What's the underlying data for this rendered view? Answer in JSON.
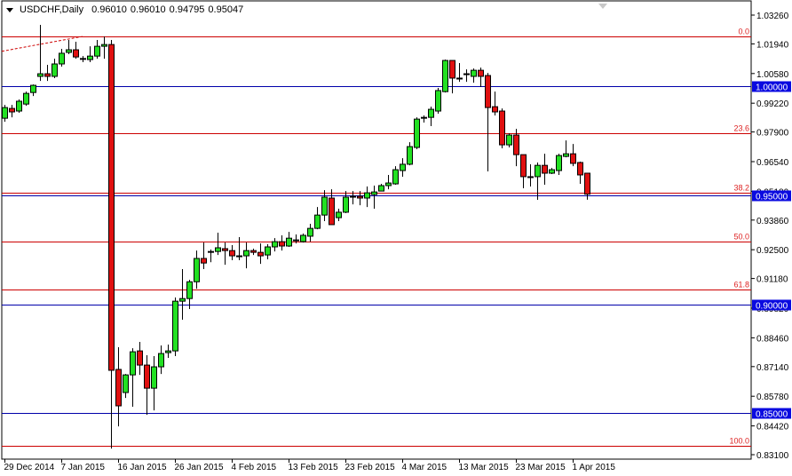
{
  "header": {
    "symbol_timeframe": "USDCHF,Daily",
    "ohlc_readout": [
      "0.96010",
      "0.96010",
      "0.94795",
      "0.95047"
    ]
  },
  "colors": {
    "bull": "#22e022",
    "bear": "#e01010",
    "outline": "#000000",
    "fib_line": "#cc0000",
    "fib_text": "#dd2222",
    "level_line": "#0000aa",
    "level_label_bg": "#0a0ae0",
    "level_label_text": "#ffffff"
  },
  "chart_data": {
    "type": "candlestick",
    "symbol": "USDCHF",
    "timeframe": "Daily",
    "ylim": [
      0.831,
      1.0326
    ],
    "y_ticks": [
      "1.03260",
      "1.01940",
      "1.00580",
      "0.99220",
      "0.97900",
      "0.96540",
      "0.95180",
      "0.93860",
      "0.92500",
      "0.91180",
      "0.89820",
      "0.88460",
      "0.87140",
      "0.85780",
      "0.84420",
      "0.83100"
    ],
    "x_ticks": [
      {
        "bar": 0,
        "label": "29 Dec 2014"
      },
      {
        "bar": 8,
        "label": "7 Jan 2015"
      },
      {
        "bar": 16,
        "label": "16 Jan 2015"
      },
      {
        "bar": 24,
        "label": "26 Jan 2015"
      },
      {
        "bar": 32,
        "label": "4 Feb 2015"
      },
      {
        "bar": 40,
        "label": "13 Feb 2015"
      },
      {
        "bar": 48,
        "label": "23 Feb 2015"
      },
      {
        "bar": 56,
        "label": "4 Mar 2015"
      },
      {
        "bar": 64,
        "label": "13 Mar 2015"
      },
      {
        "bar": 72,
        "label": "23 Mar 2015"
      },
      {
        "bar": 80,
        "label": "1 Apr 2015"
      }
    ],
    "candles_ohlc": [
      [
        0.9853,
        0.9914,
        0.9837,
        0.9902
      ],
      [
        0.9898,
        0.9914,
        0.9857,
        0.9882
      ],
      [
        0.9886,
        0.9939,
        0.9878,
        0.9931
      ],
      [
        0.9918,
        0.9975,
        0.991,
        0.9967
      ],
      [
        0.9971,
        1.0008,
        0.9955,
        1.0004
      ],
      [
        1.0045,
        1.0281,
        1.0024,
        1.0057
      ],
      [
        1.0057,
        1.0098,
        1.0024,
        1.0045
      ],
      [
        1.0045,
        1.0126,
        1.0037,
        1.0102
      ],
      [
        1.0102,
        1.0171,
        1.009,
        1.0151
      ],
      [
        1.0155,
        1.0212,
        1.0147,
        1.0167
      ],
      [
        1.0167,
        1.0204,
        1.0126,
        1.0134
      ],
      [
        1.0126,
        1.0138,
        1.011,
        1.0127
      ],
      [
        1.0122,
        1.0183,
        1.011,
        1.0138
      ],
      [
        1.0138,
        1.0212,
        1.0126,
        1.0183
      ],
      [
        1.0183,
        1.0228,
        1.0126,
        1.0191
      ],
      [
        1.0191,
        1.0212,
        0.8338,
        0.8697
      ],
      [
        0.8701,
        0.8803,
        0.844,
        0.8534
      ],
      [
        0.8595,
        0.868,
        0.857,
        0.8676
      ],
      [
        0.8676,
        0.8798,
        0.853,
        0.8782
      ],
      [
        0.8786,
        0.8827,
        0.8676,
        0.8721
      ],
      [
        0.8721,
        0.8766,
        0.8493,
        0.8615
      ],
      [
        0.8615,
        0.8762,
        0.8513,
        0.8713
      ],
      [
        0.8713,
        0.8811,
        0.868,
        0.8774
      ],
      [
        0.8778,
        0.8815,
        0.8754,
        0.8786
      ],
      [
        0.8786,
        0.9031,
        0.8762,
        0.9014
      ],
      [
        0.9014,
        0.9161,
        0.8929,
        0.9026
      ],
      [
        0.9026,
        0.9112,
        0.8978,
        0.9103
      ],
      [
        0.9103,
        0.9246,
        0.9071,
        0.921
      ],
      [
        0.921,
        0.9283,
        0.9161,
        0.9189
      ],
      [
        0.9242,
        0.9251,
        0.9193,
        0.924
      ],
      [
        0.9242,
        0.9328,
        0.9226,
        0.9259
      ],
      [
        0.9255,
        0.9283,
        0.9181,
        0.9246
      ],
      [
        0.9246,
        0.9271,
        0.9202,
        0.9222
      ],
      [
        0.9222,
        0.9308,
        0.9202,
        0.922
      ],
      [
        0.9222,
        0.9283,
        0.9165,
        0.9246
      ],
      [
        0.9246,
        0.9255,
        0.9226,
        0.9238
      ],
      [
        0.9238,
        0.9279,
        0.9185,
        0.9222
      ],
      [
        0.9226,
        0.9275,
        0.9206,
        0.9263
      ],
      [
        0.9263,
        0.9303,
        0.9242,
        0.9287
      ],
      [
        0.9287,
        0.9316,
        0.9246,
        0.9267
      ],
      [
        0.9267,
        0.9332,
        0.9263,
        0.9303
      ],
      [
        0.9295,
        0.932,
        0.9279,
        0.9291
      ],
      [
        0.9287,
        0.9324,
        0.9283,
        0.9316
      ],
      [
        0.9312,
        0.9369,
        0.9287,
        0.9348
      ],
      [
        0.9348,
        0.9446,
        0.9344,
        0.9409
      ],
      [
        0.9409,
        0.9523,
        0.9381,
        0.9491
      ],
      [
        0.9487,
        0.9527,
        0.9365,
        0.9365
      ],
      [
        0.9397,
        0.9438,
        0.9381,
        0.9422
      ],
      [
        0.9422,
        0.9519,
        0.9418,
        0.9491
      ],
      [
        0.9491,
        0.9519,
        0.9458,
        0.9495
      ],
      [
        0.9495,
        0.9519,
        0.9454,
        0.9487
      ],
      [
        0.9487,
        0.954,
        0.9446,
        0.9511
      ],
      [
        0.9503,
        0.9544,
        0.9438,
        0.9515
      ],
      [
        0.9519,
        0.9552,
        0.9519,
        0.9544
      ],
      [
        0.9544,
        0.9593,
        0.9527,
        0.9556
      ],
      [
        0.9552,
        0.9633,
        0.9548,
        0.9617
      ],
      [
        0.9613,
        0.967,
        0.9585,
        0.9642
      ],
      [
        0.9642,
        0.9743,
        0.9637,
        0.9723
      ],
      [
        0.9719,
        0.9857,
        0.9711,
        0.9849
      ],
      [
        0.9857,
        0.9866,
        0.9833,
        0.9855
      ],
      [
        0.9857,
        0.9906,
        0.9817,
        0.9894
      ],
      [
        0.9886,
        0.9992,
        0.9874,
        0.998
      ],
      [
        0.9975,
        1.0122,
        0.9971,
        1.0118
      ],
      [
        1.0118,
        1.0118,
        0.9967,
        1.0037
      ],
      [
        1.0037,
        1.0106,
        1.002,
        1.0035
      ],
      [
        1.0057,
        1.0077,
        1.002,
        1.0055
      ],
      [
        1.0045,
        1.0081,
        1.0016,
        1.0073
      ],
      [
        1.0073,
        1.0085,
        0.9996,
        1.0045
      ],
      [
        1.0049,
        1.0061,
        0.9609,
        0.9902
      ],
      [
        0.9906,
        0.9975,
        0.9866,
        0.9882
      ],
      [
        0.9886,
        0.9898,
        0.9715,
        0.9731
      ],
      [
        0.9731,
        0.9784,
        0.9719,
        0.9776
      ],
      [
        0.9776,
        0.9804,
        0.9633,
        0.9686
      ],
      [
        0.9686,
        0.9686,
        0.9532,
        0.9585
      ],
      [
        0.9585,
        0.9642,
        0.954,
        0.9583
      ],
      [
        0.9585,
        0.965,
        0.9479,
        0.9637
      ],
      [
        0.9637,
        0.969,
        0.9548,
        0.9601
      ],
      [
        0.9601,
        0.9625,
        0.9597,
        0.9617
      ],
      [
        0.9613,
        0.969,
        0.9593,
        0.9682
      ],
      [
        0.9678,
        0.9751,
        0.9674,
        0.969
      ],
      [
        0.969,
        0.9735,
        0.9633,
        0.9646
      ],
      [
        0.965,
        0.9654,
        0.9552,
        0.9593
      ],
      [
        0.9601,
        0.9601,
        0.94795,
        0.95047
      ]
    ],
    "fibonacci": {
      "high": 1.0228,
      "low": 0.835,
      "levels": [
        {
          "ratio": 0.0,
          "label": "0.0"
        },
        {
          "ratio": 0.236,
          "label": "23.6"
        },
        {
          "ratio": 0.382,
          "label": "38.2"
        },
        {
          "ratio": 0.5,
          "label": "50.0"
        },
        {
          "ratio": 0.618,
          "label": "61.8"
        },
        {
          "ratio": 1.0,
          "label": "100.0"
        }
      ]
    },
    "horizontal_levels": [
      {
        "price": 1.0,
        "label": "1.00000"
      },
      {
        "price": 0.95,
        "label": "0.95000"
      },
      {
        "price": 0.9,
        "label": "0.90000"
      },
      {
        "price": 0.85,
        "label": "0.85000"
      }
    ],
    "trendline": {
      "from": {
        "bar": -1,
        "price": 1.016
      },
      "to": {
        "bar": 11,
        "price": 1.0228
      },
      "style": "dashed"
    }
  }
}
